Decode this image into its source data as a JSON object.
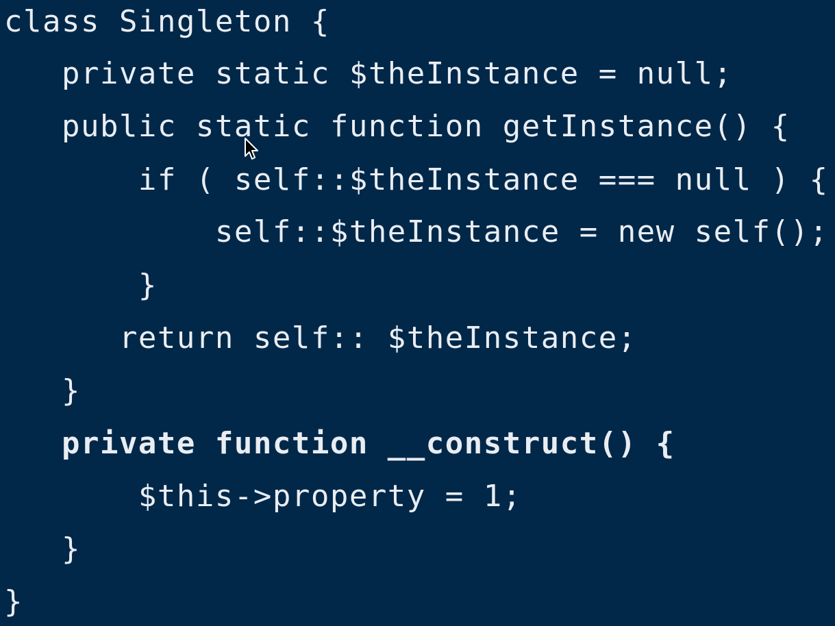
{
  "code": {
    "lines": [
      "class Singleton {",
      "   private static $theInstance = null;",
      "   public static function getInstance() {",
      "       if ( self::$theInstance === null ) {",
      "           self::$theInstance = new self();",
      "       }",
      "      return self:: $theInstance;",
      "   }",
      "   private function __construct() {",
      "       $this->property = 1;",
      "   }",
      "}"
    ]
  },
  "colors": {
    "background": "#022849",
    "text": "#e9edf2"
  },
  "icons": {
    "cursor": "mouse-pointer-icon"
  }
}
